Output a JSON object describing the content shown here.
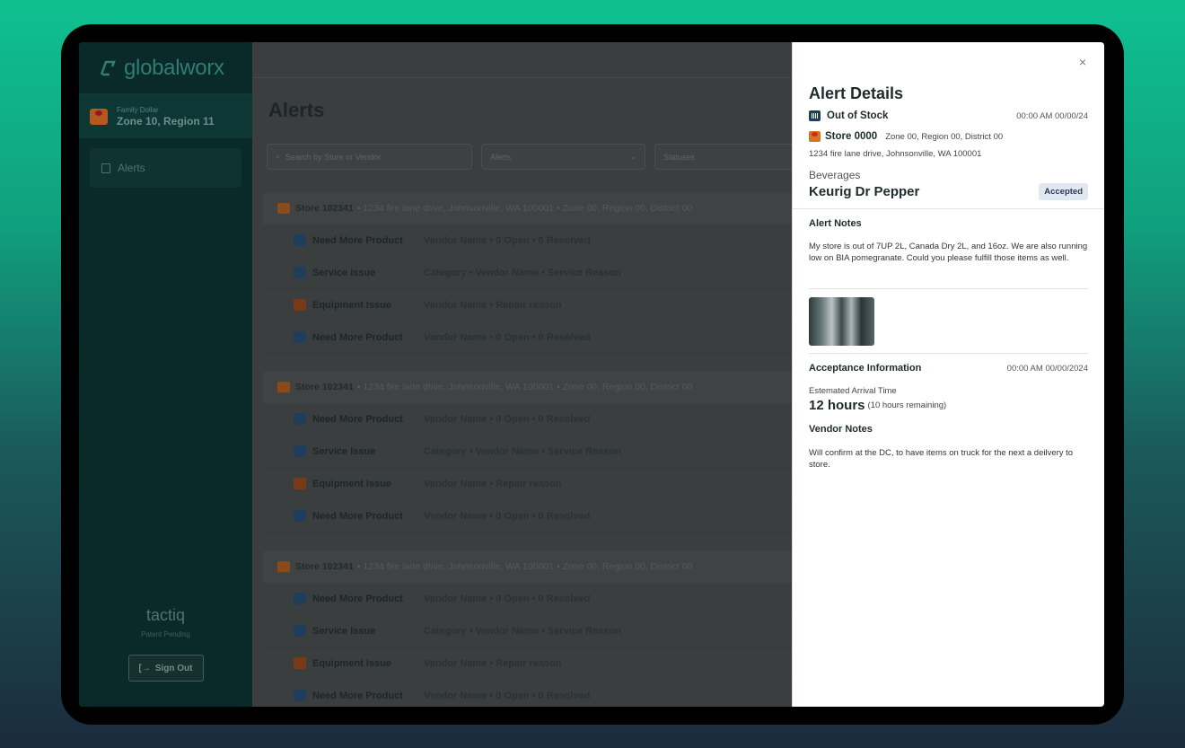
{
  "sidebar": {
    "logo": "globalworx",
    "store_brand": "Family Dollar",
    "zone": "Zone 10, Region 11",
    "nav": [
      {
        "label": "Alerts",
        "icon": "document-icon"
      }
    ],
    "footer_logo": "tactiq",
    "patent": "Patent Pending",
    "signout": "Sign Out"
  },
  "main": {
    "title": "Alerts",
    "search_placeholder": "Search by Store or Vendor",
    "alerts_filter": "Alerts",
    "statuses_filter": "Statuses",
    "groups": [
      {
        "store": "Store 102341",
        "details": "• 1234 fire lane drive, Johnsonville, WA 100001 • Zone 00, Region 00, District 00",
        "rows": [
          {
            "type": "Need More Product",
            "desc": "Vendor Name • 0 Open • 0 Resolved"
          },
          {
            "type": "Service Issue",
            "desc": "Category • Vendor Name • Service Reason"
          },
          {
            "type": "Equipment Issue",
            "desc": "Vendor Name • Repair reason"
          },
          {
            "type": "Need More Product",
            "desc": "Vendor Name • 0 Open • 0 Resolved"
          }
        ]
      },
      {
        "store": "Store 102341",
        "details": "• 1234 fire lane drive, Johnsonville, WA 100001 • Zone 00, Region 00, District 00",
        "rows": [
          {
            "type": "Need More Product",
            "desc": "Vendor Name • 0 Open • 0 Resolved"
          },
          {
            "type": "Service Issue",
            "desc": "Category • Vendor Name • Service Reason"
          },
          {
            "type": "Equipment Issue",
            "desc": "Vendor Name • Repair reason"
          },
          {
            "type": "Need More Product",
            "desc": "Vendor Name • 0 Open • 0 Resolved"
          }
        ]
      },
      {
        "store": "Store 102341",
        "details": "• 1234 fire lane drive, Johnsonville, WA 100001 • Zone 00, Region 00, District 00",
        "rows": [
          {
            "type": "Need More Product",
            "desc": "Vendor Name • 0 Open • 0 Resolved"
          },
          {
            "type": "Service Issue",
            "desc": "Category • Vendor Name • Service Reason"
          },
          {
            "type": "Equipment Issue",
            "desc": "Vendor Name • Repair reason"
          },
          {
            "type": "Need More Product",
            "desc": "Vendor Name • 0 Open • 0 Resolved"
          }
        ]
      }
    ]
  },
  "panel": {
    "close": "×",
    "title": "Alert Details",
    "alert_type": "Out of Stock",
    "alert_time": "00:00 AM 00/00/24",
    "store_name": "Store 0000",
    "store_zone": "Zone 00, Region 00, District 00",
    "address": "1234 fire lane drive, Johnsonville, WA 100001",
    "category": "Beverages",
    "vendor": "Keurig Dr Pepper",
    "status": "Accepted",
    "notes_title": "Alert Notes",
    "notes": "My store is out of 7UP 2L, Canada Dry 2L, and 16oz. We are also running low on BIA pomegranate. Could you please fulfill those items as well.",
    "acceptance_title": "Acceptance Information",
    "acceptance_time": "00:00 AM 00/00/2024",
    "eta_label": "Estemated Arrival Time",
    "eta": "12 hours",
    "eta_remaining": "(10 hours remaining)",
    "vendor_notes_title": "Vendor Notes",
    "vendor_notes": "Will confirm at the DC, to have items on truck for the next a deilvery to store."
  },
  "colors": {
    "accent": "#10c08f",
    "sidebar": "#0a2a29",
    "badge_bg": "#e2e8f2"
  }
}
